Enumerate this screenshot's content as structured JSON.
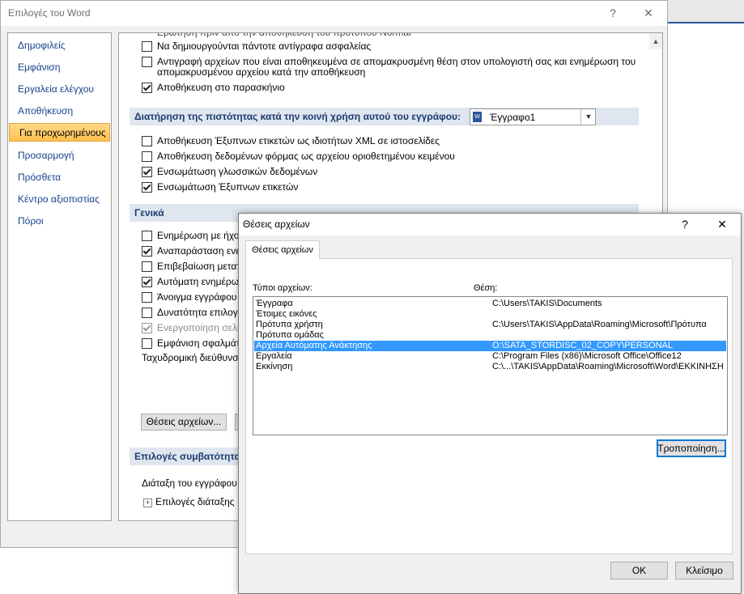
{
  "main_window": {
    "title": "Επιλογές του Word",
    "help_glyph": "?",
    "close_glyph": "✕"
  },
  "nav": {
    "items": [
      {
        "label": "Δημοφιλείς"
      },
      {
        "label": "Εμφάνιση"
      },
      {
        "label": "Εργαλεία ελέγχου"
      },
      {
        "label": "Αποθήκευση"
      },
      {
        "label": "Για προχωρημένους"
      },
      {
        "label": "Προσαρμογή"
      },
      {
        "label": "Πρόσθετα"
      },
      {
        "label": "Κέντρο αξιοπιστίας"
      },
      {
        "label": "Πόροι"
      }
    ],
    "active_index": 4
  },
  "content": {
    "partial_top_text": "Ερώτηση πριν από την αποθήκευση του προτύπου Normal",
    "save_options": [
      {
        "label": "Να δημιουργούνται πάντοτε αντίγραφα ασφαλείας",
        "checked": false
      },
      {
        "label": "Αντιγραφή αρχείων που είναι αποθηκευμένα σε απομακρυσμένη θέση στον υπολογιστή σας και ενημέρωση του",
        "label2": "απομακρυσμένου αρχείου κατά την αποθήκευση",
        "checked": false
      },
      {
        "label": "Αποθήκευση στο παρασκήνιο",
        "checked": true
      }
    ],
    "fidelity_section": {
      "title": "Διατήρηση της πιστότητας κατά την κοινή χρήση αυτού του εγγράφου:",
      "doc_select_value": "Έγγραφο1"
    },
    "fidelity_options": [
      {
        "label": "Αποθήκευση Έξυπνων ετικετών ως ιδιοτήτων XML σε ιστοσελίδες",
        "checked": false
      },
      {
        "label": "Αποθήκευση δεδομένων φόρμας ως αρχείου οριοθετημένου κειμένου",
        "checked": false
      },
      {
        "label": "Ενσωμάτωση γλωσσικών δεδομένων",
        "checked": true
      },
      {
        "label": "Ενσωμάτωση Έξυπνων ετικετών",
        "checked": true
      }
    ],
    "general_section": {
      "title": "Γενικά"
    },
    "general_options": [
      {
        "label": "Ενημέρωση με ήχο",
        "checked": false,
        "disabled": false
      },
      {
        "label": "Αναπαράσταση ενερ",
        "checked": true,
        "disabled": false
      },
      {
        "label": "Επιβεβαίωση μετατρ",
        "checked": false,
        "disabled": false
      },
      {
        "label": "Αυτόματη ενημέρωσ",
        "checked": true,
        "disabled": false
      },
      {
        "label": "Άνοιγμα εγγράφου",
        "checked": false,
        "disabled": false
      },
      {
        "label": "Δυνατότητα επιλογ",
        "checked": false,
        "disabled": false
      },
      {
        "label": "Ενεργοποίηση σελιδ",
        "checked": true,
        "disabled": true
      },
      {
        "label": "Εμφάνιση σφαλμάτ",
        "checked": false,
        "disabled": false
      }
    ],
    "mail_address_label": "Ταχυδρομική διεύθυνση",
    "file_locations_button": "Θέσεις αρχείων...",
    "compat_section": {
      "title": "Επιλογές συμβατότητας"
    },
    "layout_label": "Διάταξη του εγγράφου",
    "layout_options_label": "Επιλογές διάταξης",
    "plus_glyph": "+"
  },
  "dialog": {
    "title": "Θέσεις αρχείων",
    "help_glyph": "?",
    "close_glyph": "✕",
    "tab_label": "Θέσεις αρχείων",
    "col_type_header": "Τύποι αρχείων:",
    "col_location_header": "Θέση:",
    "rows": [
      {
        "type": "Έγγραφα",
        "location": "C:\\Users\\TAKIS\\Documents"
      },
      {
        "type": "Έτοιμες εικόνες",
        "location": ""
      },
      {
        "type": "Πρότυπα χρήστη",
        "location": "C:\\Users\\TAKIS\\AppData\\Roaming\\Microsoft\\Πρότυπα"
      },
      {
        "type": "Πρότυπα ομάδας",
        "location": ""
      },
      {
        "type": "Αρχεία Αυτόματης Ανάκτησης",
        "location": "O:\\SATA_STORDISC_02_COPY\\PERSONAL"
      },
      {
        "type": "Εργαλεία",
        "location": "C:\\Program Files (x86)\\Microsoft Office\\Office12"
      },
      {
        "type": "Εκκίνηση",
        "location": "C:\\...\\TAKIS\\AppData\\Roaming\\Microsoft\\Word\\ΕΚΚΙΝΗΣΗ"
      }
    ],
    "selected_row": 4,
    "modify_button": "Τροποποίηση...",
    "ok_button": "OK",
    "close_button": "Κλείσιμο"
  }
}
